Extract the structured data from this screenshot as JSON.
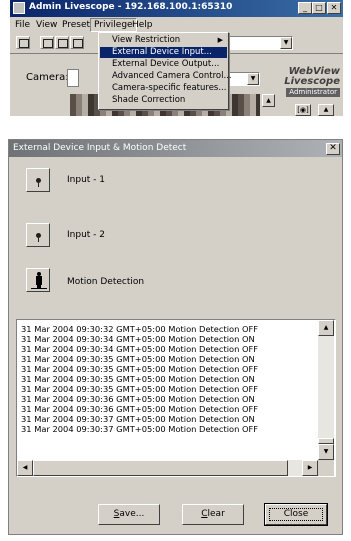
{
  "app": {
    "title": "Admin Livescope - 192.168.100.1:65310",
    "menu": [
      "File",
      "View",
      "Preset",
      "Privilege",
      "Help"
    ],
    "camera_label": "Camera:",
    "brand_line1": "WebView",
    "brand_line2": "Livescope",
    "brand_badge": "Administrator"
  },
  "privilege_menu": {
    "items": [
      {
        "label": "View Restriction",
        "submenu": true
      },
      {
        "label": "External Device Input...",
        "selected": true
      },
      {
        "label": "External Device Output..."
      },
      {
        "label": "Advanced Camera Control..."
      },
      {
        "label": "Camera-specific features..."
      },
      {
        "label": "Shade Correction"
      }
    ]
  },
  "dialog": {
    "title": "External Device Input & Motion Detect",
    "inputs": [
      {
        "label": "Input - 1"
      },
      {
        "label": "Input - 2"
      }
    ],
    "motion_label": "Motion Detection",
    "log": [
      "31 Mar 2004  09:30:32  GMT+05:00  Motion Detection OFF",
      "31 Mar 2004  09:30:34  GMT+05:00  Motion Detection ON",
      "31 Mar 2004  09:30:34  GMT+05:00  Motion Detection OFF",
      "31 Mar 2004  09:30:35  GMT+05:00  Motion Detection ON",
      "31 Mar 2004  09:30:35  GMT+05:00  Motion Detection OFF",
      "31 Mar 2004  09:30:35  GMT+05:00  Motion Detection ON",
      "31 Mar 2004  09:30:35  GMT+05:00  Motion Detection OFF",
      "31 Mar 2004  09:30:36  GMT+05:00  Motion Detection ON",
      "31 Mar 2004  09:30:36  GMT+05:00  Motion Detection OFF",
      "31 Mar 2004  09:30:37  GMT+05:00  Motion Detection ON",
      "31 Mar 2004  09:30:37  GMT+05:00  Motion Detection OFF"
    ],
    "buttons": {
      "save_mnemonic": "S",
      "save_rest": "ave...",
      "clear_mnemonic": "C",
      "clear_rest": "lear",
      "close": "Close"
    }
  }
}
